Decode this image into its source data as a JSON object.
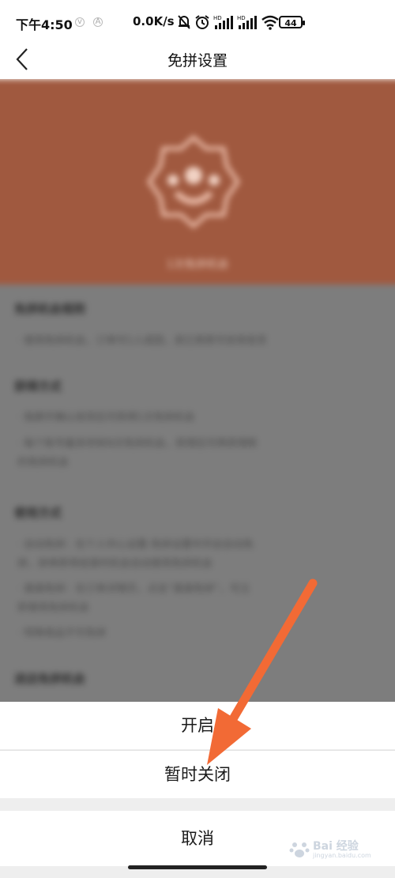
{
  "status_bar": {
    "time": "下午4:50",
    "speed": "0.0K/s",
    "battery": "44",
    "icons": [
      "v-badge-icon",
      "a-badge-icon",
      "mute-bell-icon",
      "alarm-icon",
      "hd-signal-icon",
      "hd-signal-icon",
      "wifi-icon",
      "battery-icon"
    ]
  },
  "header": {
    "title": "免拼设置",
    "back_icon": "back-chevron-icon"
  },
  "background_content": {
    "banner_caption": "1次免拼机会",
    "sections": [
      {
        "heading": "免拼机会规则",
        "lines": [
          "· 使用免拼机会，订单可1人成团，其它商家可安排发货"
        ]
      },
      {
        "heading": "获得方式",
        "lines": [
          "· 拖屏开确认收货后可获得1次免拼机会",
          "· 每个账号最多持有N次免拼机会，获得后可再获得新",
          "  的免拼机会"
        ]
      },
      {
        "heading": "使用方式",
        "lines": [
          "· 自动免拼：在个人中心设置-免拼设置中开启自动免",
          "  拼，拼单即将结束时机会自动使用免拼机会",
          "· 直接免拼：在订单详情页，点击“直接免拼”，可立",
          "  即使用免拼机会",
          "· 特殊商品不可免拼"
        ]
      },
      {
        "heading": "进店免拼机会",
        "lines": []
      }
    ]
  },
  "action_sheet": {
    "open_label": "开启",
    "temp_close_label": "暂时关闭",
    "cancel_label": "取消"
  },
  "colors": {
    "banner": "#a0593f",
    "overlay": "#7d7d7d",
    "arrow": "#f26a35"
  },
  "watermark": {
    "text": "Bai 经验",
    "sub": "jingyan.baidu.com"
  }
}
